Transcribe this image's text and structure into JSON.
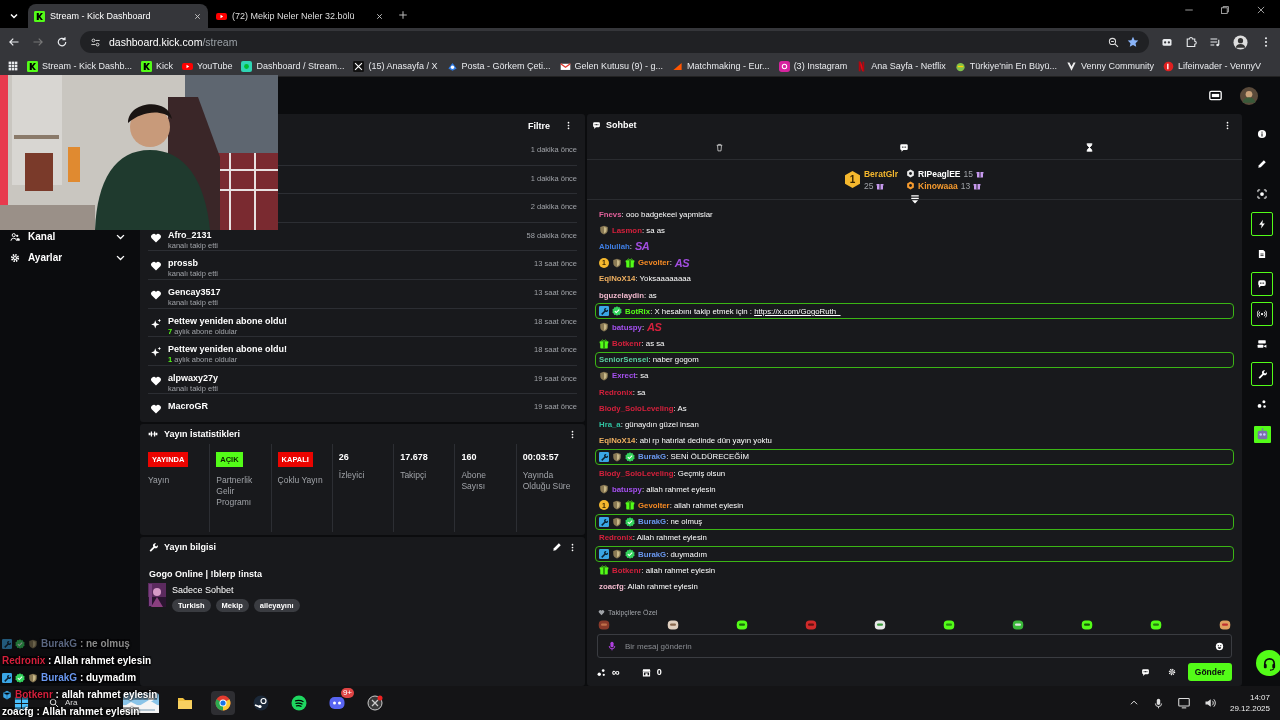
{
  "browser": {
    "tabs": [
      {
        "title": "Stream - Kick Dashboard",
        "selected": true
      },
      {
        "title": "(72) Mekip Neler Neler 32.bölü",
        "selected": false
      }
    ],
    "url_host": "dashboard.kick.com",
    "url_path": "/stream",
    "bookmarks": [
      {
        "label": "Stream - Kick Dashb..."
      },
      {
        "label": "Kick"
      },
      {
        "label": "YouTube"
      },
      {
        "label": "Dashboard / Stream..."
      },
      {
        "label": "(15) Anasayfa / X"
      },
      {
        "label": "Posta - Görkem Çeti..."
      },
      {
        "label": "Gelen Kutusu (9) - g..."
      },
      {
        "label": "Matchmaking - Eur..."
      },
      {
        "label": "(3) Instagram"
      },
      {
        "label": "Ana Sayfa - Netflix"
      },
      {
        "label": "Türkiye'nin En Büyü..."
      },
      {
        "label": "Venny Community"
      },
      {
        "label": "Lifeinvader - VennyV"
      }
    ]
  },
  "nav": [
    {
      "label": "Kanal"
    },
    {
      "label": "Ayarlar"
    }
  ],
  "activity": {
    "filter": "Filtre",
    "items": [
      {
        "time": "1 dakika önce"
      },
      {
        "time": "1 dakika önce"
      },
      {
        "time": "2 dakika önce"
      },
      {
        "kind": "follow",
        "name": "Afro_2131",
        "detail": "kanalı takip etti",
        "time": "58 dakika önce"
      },
      {
        "kind": "follow",
        "name": "prossb",
        "detail": "kanalı takip etti",
        "time": "13 saat önce"
      },
      {
        "kind": "follow",
        "name": "Gencay3517",
        "detail": "kanalı takip etti",
        "time": "13 saat önce"
      },
      {
        "kind": "resub",
        "name": "Pettew yeniden abone oldu!",
        "months": "7",
        "detail": "aylık abone oldular",
        "time": "18 saat önce"
      },
      {
        "kind": "resub",
        "name": "Pettew yeniden abone oldu!",
        "months": "1",
        "detail": "aylık abone oldular",
        "time": "18 saat önce"
      },
      {
        "kind": "follow",
        "name": "alpwaxy27y",
        "detail": "kanalı takip etti",
        "time": "19 saat önce"
      },
      {
        "kind": "follow",
        "name": "MacroGR",
        "time": "19 saat önce"
      }
    ]
  },
  "stats": {
    "title": "Yayın İstatistikleri",
    "items": [
      {
        "kind": "status",
        "badge": "YAYINDA",
        "color": "#eb0400",
        "label": "Yayın"
      },
      {
        "kind": "status",
        "badge": "AÇIK",
        "color": "#53fc18",
        "label": "Partnerlik Gelir Programı"
      },
      {
        "kind": "status",
        "badge": "KAPALI",
        "color": "#eb0400",
        "label": "Çoklu Yayın"
      },
      {
        "kind": "metric",
        "value": "26",
        "label": "İzleyici"
      },
      {
        "kind": "metric",
        "value": "17.678",
        "label": "Takipçi"
      },
      {
        "kind": "metric",
        "value": "160",
        "label": "Abone Sayısı"
      },
      {
        "kind": "metric",
        "value": "00:03:57",
        "label": "Yayında Olduğu Süre"
      }
    ]
  },
  "stream_info": {
    "title": "Yayın bilgisi",
    "stream_title": "Gogo Online | !blerp !insta",
    "category": "Sadece Sohbet",
    "tags": [
      "Turkish",
      "Mekip",
      "aileyayını"
    ]
  },
  "chat": {
    "title": "Sohbet",
    "leaderboard": [
      {
        "rank": "1",
        "name": "BeratGlr",
        "count": "25",
        "color": "#f5b82e"
      },
      {
        "name": "RIPeaglEE",
        "count": "15",
        "color": "#ffffff"
      },
      {
        "name": "Kinowaaa",
        "count": "13",
        "color": "#f59a2e"
      }
    ],
    "messages": [
      {
        "user": "Fnevs",
        "color": "#e0609a",
        "text": ": ooo badgekeei yapmislar",
        "highlight": false
      },
      {
        "user": "Lasmon",
        "color": "#d4203c",
        "text": ": sa as",
        "highlight": false,
        "badges": [
          {
            "kind": "shield"
          }
        ]
      },
      {
        "user": "Ablullah",
        "color": "#3f7fe6",
        "text": ":",
        "emote": {
          "text": "SA",
          "color": "#a24ee0"
        },
        "highlight": false
      },
      {
        "user": "Gevolter",
        "color": "#f58a24",
        "text": ":",
        "emote": {
          "text": "AS",
          "color": "#a24ee0"
        },
        "highlight": false,
        "badges": [
          {
            "kind": "rank",
            "label": "1"
          },
          {
            "kind": "shield"
          },
          {
            "kind": "sub"
          }
        ]
      },
      {
        "user": "EqlNoX14",
        "color": "#f0b060",
        "text": ": Yoksaaaaaaaa",
        "highlight": false
      },
      {
        "user": "bguzelaydin",
        "color": "#f0b8cc",
        "text": ": as",
        "highlight": false
      },
      {
        "user": "BotRix",
        "color": "#53fc18",
        "text": ": X hesabını takip etmek için : ",
        "link": "https://x.com/GogoRuth_",
        "highlight": true,
        "badges": [
          {
            "kind": "mod"
          },
          {
            "kind": "verified"
          }
        ]
      },
      {
        "user": "batuspy",
        "color": "#a550f0",
        "text": ":",
        "emote": {
          "text": "AS",
          "color": "#d4203c"
        },
        "highlight": false,
        "badges": [
          {
            "kind": "shield"
          }
        ]
      },
      {
        "user": "Botkenr",
        "color": "#d4203c",
        "text": ": as sa",
        "highlight": false,
        "badges": [
          {
            "kind": "sub"
          }
        ]
      },
      {
        "user": "SeniorSensei",
        "color": "#5ad0a0",
        "text": ": naber gogom",
        "highlight": true
      },
      {
        "user": "Exrect",
        "color": "#a550f0",
        "text": ": sa",
        "highlight": false,
        "badges": [
          {
            "kind": "shield"
          }
        ]
      },
      {
        "user": "Redronix",
        "color": "#d4203c",
        "text": ": sa",
        "highlight": false
      },
      {
        "user": "Blody_SoloLeveling",
        "color": "#d4203c",
        "text": ": As",
        "highlight": false
      },
      {
        "user": "Hra_a",
        "color": "#30c0a0",
        "text": ": günaydın güzel insan",
        "highlight": false
      },
      {
        "user": "EqlNoX14",
        "color": "#f0b060",
        "text": ": abi rp hatırlat dedinde dün yayın yoktu",
        "highlight": false
      },
      {
        "user": "BurakG",
        "color": "#6a98f0",
        "text": ": SENİ ÖLDÜRECEĞİM",
        "highlight": true,
        "badges": [
          {
            "kind": "mod"
          },
          {
            "kind": "shield"
          },
          {
            "kind": "verified"
          }
        ]
      },
      {
        "user": "Blody_SoloLeveling",
        "color": "#d4203c",
        "text": ": Geçmiş olsun",
        "highlight": false
      },
      {
        "user": "batuspy",
        "color": "#a550f0",
        "text": ": allah rahmet eylesin",
        "highlight": false,
        "badges": [
          {
            "kind": "shield"
          }
        ]
      },
      {
        "user": "Gevolter",
        "color": "#f58a24",
        "text": ": allah rahmet eylesin",
        "highlight": false,
        "badges": [
          {
            "kind": "rank",
            "label": "1"
          },
          {
            "kind": "shield"
          },
          {
            "kind": "sub"
          }
        ]
      },
      {
        "user": "BurakG",
        "color": "#6a98f0",
        "text": ": ne olmuş",
        "highlight": true,
        "badges": [
          {
            "kind": "mod"
          },
          {
            "kind": "shield"
          },
          {
            "kind": "verified"
          }
        ]
      },
      {
        "user": "Redronix",
        "color": "#d4203c",
        "text": ": Allah rahmet eylesin",
        "highlight": false
      },
      {
        "user": "BurakG",
        "color": "#6a98f0",
        "text": ": duymadım",
        "highlight": true,
        "badges": [
          {
            "kind": "mod"
          },
          {
            "kind": "shield"
          },
          {
            "kind": "verified"
          }
        ]
      },
      {
        "user": "Botkenr",
        "color": "#d4203c",
        "text": ": allah rahmet eylesin",
        "highlight": false,
        "badges": [
          {
            "kind": "sub"
          }
        ]
      },
      {
        "user": "zoacfg",
        "color": "#f0b8cc",
        "text": ": Allah rahmet eylesin",
        "highlight": false
      }
    ],
    "followers_only": "Takipçilere Özel",
    "placeholder": "Bir mesaj gönderin",
    "points": "∞",
    "store_count": "0",
    "send": "Gönder"
  },
  "rail": [
    {
      "kind": "info",
      "on": false
    },
    {
      "kind": "pencil",
      "on": false
    },
    {
      "kind": "scan",
      "on": false
    },
    {
      "kind": "bolt",
      "on": true
    },
    {
      "kind": "doc",
      "on": false
    },
    {
      "kind": "chat",
      "on": true
    },
    {
      "kind": "broadcast",
      "on": true
    },
    {
      "kind": "video",
      "on": false
    },
    {
      "kind": "wrench",
      "on": true
    },
    {
      "kind": "nodes",
      "on": false
    },
    {
      "kind": "robot",
      "on": false
    }
  ],
  "overlay_chat": [
    {
      "user": "BurakG",
      "color": "#5a6680",
      "text": " : ne olmuş",
      "faded": true,
      "badges": [
        {
          "kind": "mod"
        },
        {
          "kind": "verified"
        },
        {
          "kind": "shield"
        }
      ]
    },
    {
      "user": "Redronix",
      "color": "#d4203c",
      "text": " : Allah rahmet eylesin",
      "faded": false
    },
    {
      "user": "BurakG",
      "color": "#6a98f0",
      "text": " : duymadım",
      "faded": false,
      "badges": [
        {
          "kind": "mod"
        },
        {
          "kind": "verified"
        },
        {
          "kind": "shield"
        }
      ]
    },
    {
      "user": "Botkenr",
      "color": "#d4203c",
      "text": " : allah rahmet eylesin",
      "faded": false,
      "badges": [
        {
          "kind": "cube"
        }
      ]
    },
    {
      "user": "zoacfg",
      "color": "#ffffff",
      "text": " : Allah rahmet eylesin",
      "faded": false
    }
  ],
  "taskbar": {
    "search": "Ara",
    "apps": [
      {
        "kind": "widget"
      },
      {
        "kind": "folder"
      },
      {
        "kind": "chrome",
        "selected": true
      },
      {
        "kind": "steam",
        "selected": false
      },
      {
        "kind": "spotify",
        "selected": false
      },
      {
        "kind": "discord",
        "badge": "9+",
        "selected": false
      },
      {
        "kind": "app",
        "selected": false
      }
    ],
    "time": "14:07",
    "date": "29.12.2025"
  }
}
